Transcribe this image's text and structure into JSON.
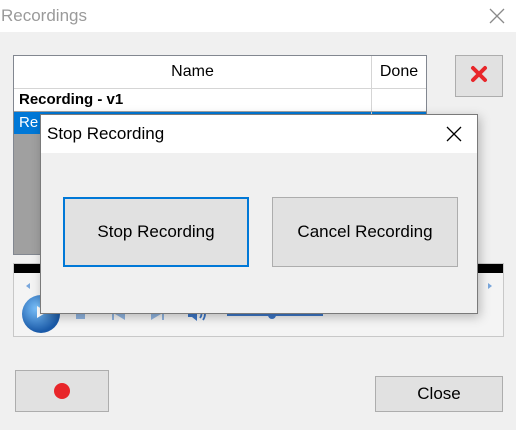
{
  "main_window": {
    "title": "Recordings",
    "list": {
      "columns": [
        "Name",
        "Done"
      ],
      "rows": [
        {
          "name": "Recording - v1",
          "done": ""
        },
        {
          "name": "Re",
          "done": "",
          "selected": true
        }
      ]
    },
    "delete_icon": "red-x-icon",
    "close_label": "Close",
    "record_icon": "record-dot-icon"
  },
  "player": {
    "icons": [
      "play-icon",
      "stop-icon",
      "previous-icon",
      "next-icon",
      "volume-icon"
    ]
  },
  "dialog": {
    "title": "Stop Recording",
    "stop_label": "Stop Recording",
    "cancel_label": "Cancel Recording"
  },
  "colors": {
    "selection": "#0078d7",
    "record": "#e8262a",
    "delete": "#e8262a"
  }
}
